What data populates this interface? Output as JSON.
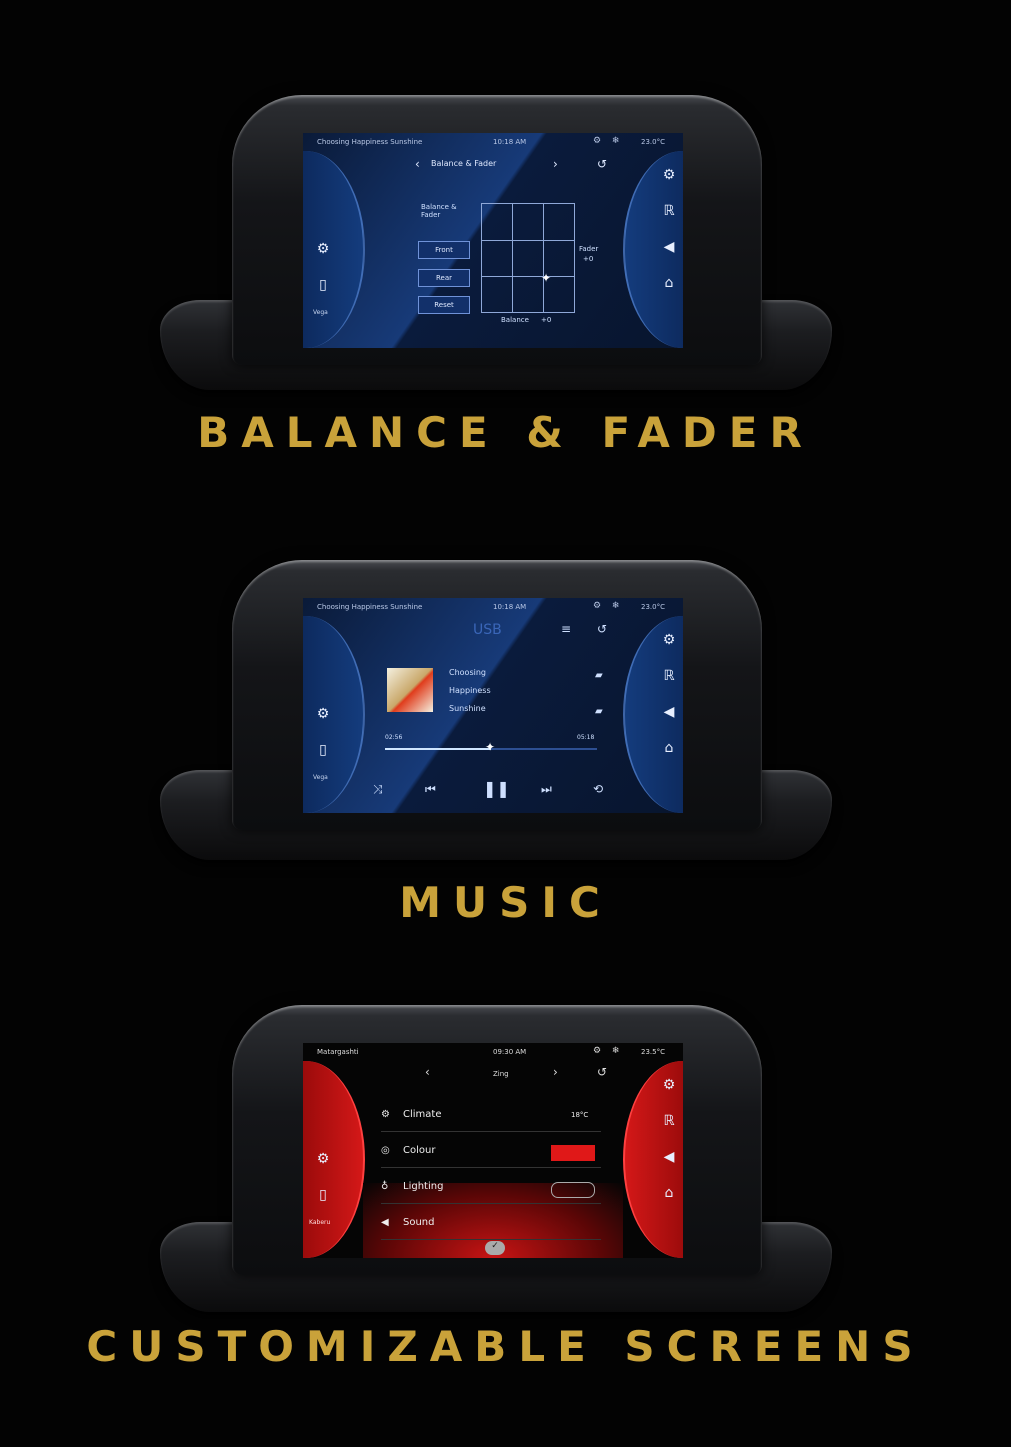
{
  "sections": {
    "balance": {
      "caption": "BALANCE & FADER",
      "status": {
        "song": "Choosing Happiness Sunshine",
        "clock": "10:18 AM",
        "temp": "23.0°C"
      },
      "nav_title": "Balance & Fader",
      "panel_title": "Balance & Fader",
      "buttons": {
        "front": "Front",
        "rear": "Rear",
        "reset": "Reset"
      },
      "fader_label": "Fader",
      "fader_value": "+0",
      "balance_label": "Balance",
      "balance_value": "+0",
      "side_label": "Vega"
    },
    "music": {
      "caption": "MUSIC",
      "status": {
        "song": "Choosing Happiness Sunshine",
        "clock": "10:18 AM",
        "temp": "23.0°C"
      },
      "source": "USB",
      "track_lines": [
        "Choosing",
        "Happiness",
        "Sunshine"
      ],
      "elapsed": "02:56",
      "duration": "05:18",
      "progress": 0.5,
      "side_label": "Vega"
    },
    "custom": {
      "caption": "CUSTOMIZABLE SCREENS",
      "status": {
        "song": "Matargashti",
        "clock": "09:30 AM",
        "temp": "23.5°C"
      },
      "nav_item": "Zing",
      "rows": [
        {
          "label": "Climate",
          "value": "18°C"
        },
        {
          "label": "Colour",
          "value": ""
        },
        {
          "label": "Lighting",
          "value": ""
        },
        {
          "label": "Sound",
          "value": ""
        }
      ],
      "accent_color": "#e01818",
      "side_label": "Kaberu"
    }
  }
}
